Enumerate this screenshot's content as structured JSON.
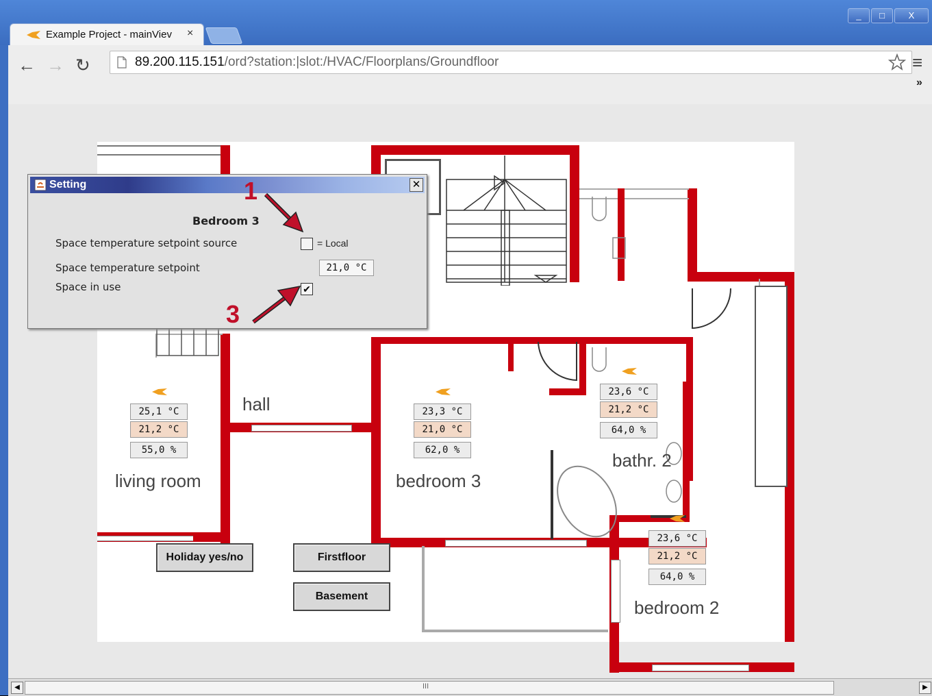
{
  "browser": {
    "tab_title": "Example Project - mainViev",
    "tab_close": "×",
    "url_host": "89.200.115.151",
    "url_path": "/ord?station:|slot:/HVAC/Floorplans/Groundfloor",
    "window_min": "_",
    "window_max": "□",
    "window_close": "X",
    "overflow": "»",
    "menu": "≡"
  },
  "dialog": {
    "title": "Setting",
    "close": "✕",
    "heading": "Bedroom 3",
    "rows": [
      {
        "label": "Space temperature setpoint source",
        "checked": false,
        "suffix": "= Local"
      },
      {
        "label": "Space temperature setpoint",
        "value": "21,0 °C"
      },
      {
        "label": "Space in use",
        "checked": true
      }
    ],
    "check_mark": "✔"
  },
  "annotations": {
    "one": "1",
    "three": "3"
  },
  "rooms": [
    {
      "name": "living room",
      "temp": "25,1 °C",
      "setpoint": "21,2 °C",
      "humidity": "55,0 %"
    },
    {
      "name": "hall"
    },
    {
      "name": "bedroom  3",
      "temp": "23,3 °C",
      "setpoint": "21,0 °C",
      "humidity": "62,0 %"
    },
    {
      "name": "bathr. 2",
      "temp": "23,6 °C",
      "setpoint": "21,2 °C",
      "humidity": "64,0 %"
    },
    {
      "name": "bedroom 2",
      "temp": "23,6 °C",
      "setpoint": "21,2 °C",
      "humidity": "64,0 %"
    }
  ],
  "buttons": {
    "holiday": "Holiday yes/no",
    "firstfloor": "Firstfloor",
    "basement": "Basement"
  },
  "scrollbar": {
    "grip": "III"
  },
  "colors": {
    "wall": "#c8000e",
    "setpoint_bg": "#f3d9c7",
    "fan": "#f0a020"
  }
}
